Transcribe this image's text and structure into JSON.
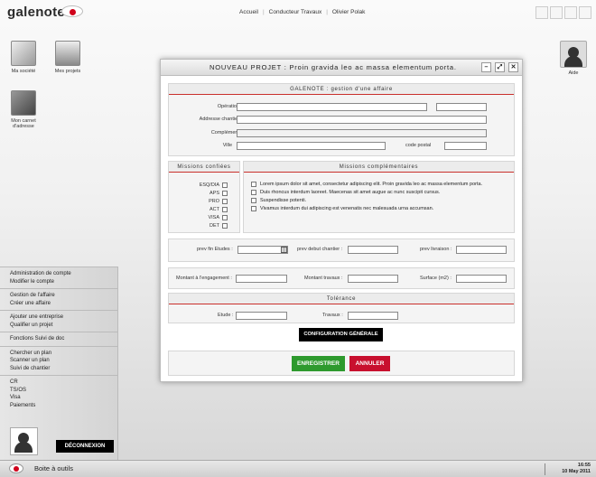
{
  "app": {
    "logo_text": "galenote",
    "colors": {
      "brand_red": "#d0021b",
      "save_green": "#2e9a2e",
      "cancel_red": "#c8102e",
      "accent_line": "#c9302c"
    }
  },
  "topnav": {
    "home": "Accueil",
    "role": "Conducteur Travaux",
    "user": "Olivier Polak"
  },
  "desktop": {
    "societe": "Ma société",
    "projets": "Mes projets",
    "carnet_line1": "Mon carnet",
    "carnet_line2": "d'adresse",
    "aide": "Aide"
  },
  "menu": {
    "groups": [
      {
        "items": [
          "Administration de compte",
          "Modifier le compte"
        ]
      },
      {
        "items": [
          "Gestion de l'affaire",
          "Créer une affaire"
        ]
      },
      {
        "items": [
          "Ajouter une entreprise",
          "Qualifier un projet"
        ]
      },
      {
        "items": [
          "Fonctions Suivi de doc"
        ]
      },
      {
        "items": [
          "Chercher un plan",
          "Scanner un plan",
          "Suivi de chantier"
        ]
      },
      {
        "items": [
          "CR",
          "TS/OS",
          "Visa",
          "Paiements"
        ]
      }
    ],
    "logout": "DÉCONNEXION"
  },
  "bottombar": {
    "label": "Boite à outils",
    "time": "16:55",
    "date": "10 May 2011"
  },
  "modal": {
    "title": "NOUVEAU PROJET : Proin gravida leo ac massa elementum porta.",
    "btn_min": "–",
    "btn_max": "⤢",
    "btn_close": "✕",
    "section_main": "GALENOTE : gestion d'une affaire",
    "fields": {
      "operation": "Opération",
      "adresse": "Addresse chantier",
      "complement": "Complément",
      "ville": "Ville",
      "code_postal": "code postal"
    },
    "missions_confiees": {
      "title": "Missions confiées",
      "items": [
        "ESQ/DIA",
        "APS",
        "PRO",
        "ACT",
        "VISA",
        "DET"
      ]
    },
    "missions_complementaires": {
      "title": "Missions complémentaires",
      "items": [
        "Lorem ipsum dolor sit amet, consectetur adipiscing elit. Proin gravida leo ac massa elementum porta.",
        "Duis rhoncus interdum laoreet. Maecenas sit amet augue ac nunc suscipit cursus.",
        "Suspendisse potenti.",
        "Vivamus interdum dui adipiscing est venenatis nec malesuada urna accumsan."
      ]
    },
    "dates": {
      "prev_fin_etudes": "prev fin Etudes :",
      "prev_debut_chantier": "prev debut chantier :",
      "prev_livraison": "prev livraison :"
    },
    "montants": {
      "engagement": "Montant à l'engagement :",
      "travaux": "Montant travaux :",
      "surface": "Surface (m2) :"
    },
    "tolerance": {
      "title": "Tolérance",
      "etude": "Etude :",
      "travaux": "Travaux :"
    },
    "config_button": "CONFIGURATION GÉNÉRALE",
    "save_button": "ENREGISTRER",
    "cancel_button": "ANNULER"
  }
}
